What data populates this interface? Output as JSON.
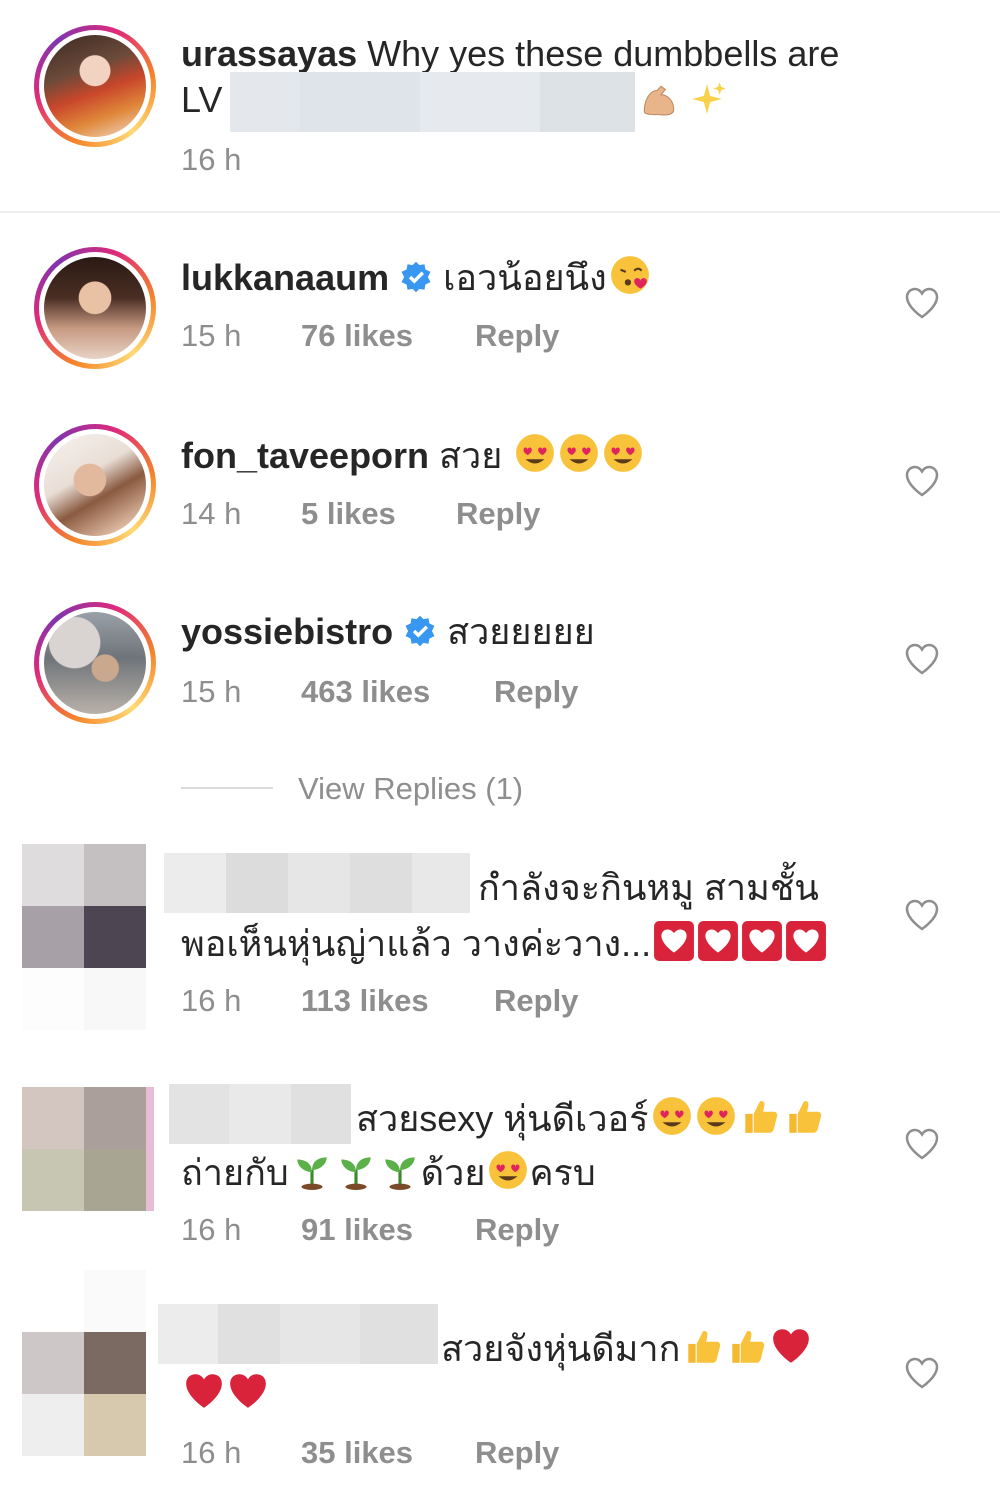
{
  "comments": [
    {
      "username": "urassayas",
      "text_line1": " Why yes these dumbbells are",
      "text_line2": "LV",
      "time": "16 h",
      "emojis": [
        "flexed-biceps",
        "sparkles"
      ]
    },
    {
      "username": "lukkanaaum",
      "verified": true,
      "text": "เอวน้อยนึง",
      "emojis": [
        "face-blowing-kiss"
      ],
      "time": "15 h",
      "likes": "76 likes",
      "reply": "Reply"
    },
    {
      "username": "fon_taveeporn",
      "text": " สวย ",
      "emojis": [
        "heart-eyes",
        "heart-eyes",
        "heart-eyes"
      ],
      "time": "14 h",
      "likes": "5 likes",
      "reply": "Reply"
    },
    {
      "username": "yossiebistro",
      "verified": true,
      "text": "สวยยยยย",
      "time": "15 h",
      "likes": "463 likes",
      "reply": "Reply",
      "view_replies": "View Replies (1)"
    },
    {
      "text_line1": "กำลังจะกินหมู สามชั้น",
      "text_line2": "พอเห็นหุ่นญ่าแล้ว วางค่ะวาง...",
      "emojis": [
        "white-heart-box",
        "white-heart-box",
        "white-heart-box",
        "white-heart-box"
      ],
      "time": "16 h",
      "likes": "113 likes",
      "reply": "Reply"
    },
    {
      "text_line1": "สวยsexy หุ่นดีเวอร์",
      "text_line2a": "ถ่ายกับ",
      "text_line2b": "ด้วย",
      "text_line2c": "ครบ",
      "emojis_line1": [
        "heart-eyes",
        "heart-eyes",
        "thumbs-up",
        "thumbs-up"
      ],
      "emojis_line2": [
        "seedling",
        "seedling",
        "seedling",
        "heart-eyes"
      ],
      "time": "16 h",
      "likes": "91 likes",
      "reply": "Reply"
    },
    {
      "text_line1": "สวยจังหุ่นดีมาก",
      "emojis_line1": [
        "thumbs-up",
        "thumbs-up",
        "red-heart"
      ],
      "emojis_line2": [
        "red-heart",
        "red-heart"
      ],
      "time": "16 h",
      "likes": "35 likes",
      "reply": "Reply"
    }
  ],
  "colors": {
    "text": "#262626",
    "meta": "#8e8e8e",
    "verified_blue": "#3897f0",
    "ring_orange": "#f58529",
    "ring_pink": "#dd2a7b",
    "heart_outline": "#8e8e8e"
  }
}
